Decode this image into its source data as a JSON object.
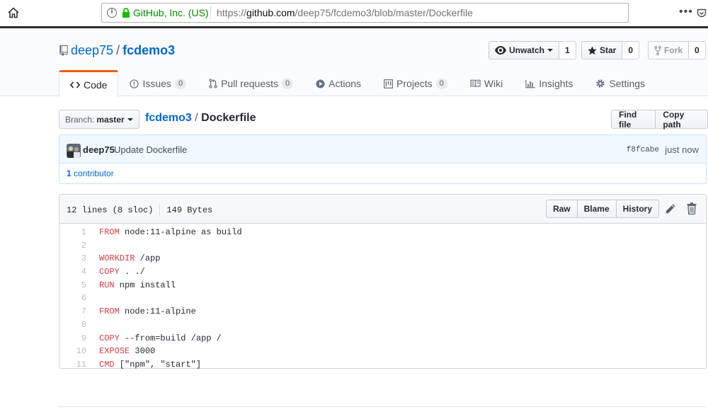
{
  "browser": {
    "org": "GitHub, Inc. (US)",
    "url_prefix": "https://",
    "url_host": "github.com",
    "url_path": "/deep75/fcdemo3/blob/master/Dockerfile",
    "menu_dots": "•••"
  },
  "repo": {
    "owner": "deep75",
    "separator": "/",
    "name": "fcdemo3"
  },
  "actions": {
    "watch_label": "Unwatch",
    "watch_count": "1",
    "star_label": "Star",
    "star_count": "0",
    "fork_label": "Fork",
    "fork_count": "0"
  },
  "tabs": [
    {
      "label": "Code",
      "icon": "code-icon"
    },
    {
      "label": "Issues",
      "count": "0",
      "icon": "issue-icon"
    },
    {
      "label": "Pull requests",
      "count": "0",
      "icon": "pull-request-icon"
    },
    {
      "label": "Actions",
      "icon": "play-icon"
    },
    {
      "label": "Projects",
      "count": "0",
      "icon": "project-icon"
    },
    {
      "label": "Wiki",
      "icon": "book-icon"
    },
    {
      "label": "Insights",
      "icon": "graph-icon"
    },
    {
      "label": "Settings",
      "icon": "gear-icon"
    }
  ],
  "filenav": {
    "branch_prefix": "Branch:",
    "branch": "master",
    "breadcrumb_repo": "fcdemo3",
    "breadcrumb_sep": "/",
    "breadcrumb_file": "Dockerfile",
    "find_file": "Find file",
    "copy_path": "Copy path"
  },
  "commit": {
    "author": "deep75",
    "message": "Update Dockerfile",
    "sha": "f8fcabe",
    "time": "just now",
    "contributors_count": "1",
    "contributors_label": "contributor"
  },
  "file": {
    "lines_info": "12 lines (8 sloc)",
    "size": "149 Bytes",
    "raw": "Raw",
    "blame": "Blame",
    "history": "History",
    "code": [
      {
        "n": "1",
        "kw": "FROM",
        "rest": " node:11-alpine as build"
      },
      {
        "n": "2",
        "kw": "",
        "rest": ""
      },
      {
        "n": "3",
        "kw": "WORKDIR",
        "rest": " /app"
      },
      {
        "n": "4",
        "kw": "COPY",
        "rest": " . ./"
      },
      {
        "n": "5",
        "kw": "RUN",
        "rest": " npm install"
      },
      {
        "n": "6",
        "kw": "",
        "rest": ""
      },
      {
        "n": "7",
        "kw": "FROM",
        "rest": " node:11-alpine"
      },
      {
        "n": "8",
        "kw": "",
        "rest": ""
      },
      {
        "n": "9",
        "kw": "COPY",
        "rest": " --from=build /app /"
      },
      {
        "n": "10",
        "kw": "EXPOSE",
        "rest": " 3000"
      },
      {
        "n": "11",
        "kw": "CMD",
        "rest": " [\"npm\", \"start\"]"
      }
    ]
  },
  "colors": {
    "link": "#0366d6",
    "keyword": "#d73a49",
    "tab_accent": "#e36209",
    "secure_green": "#058b00"
  }
}
